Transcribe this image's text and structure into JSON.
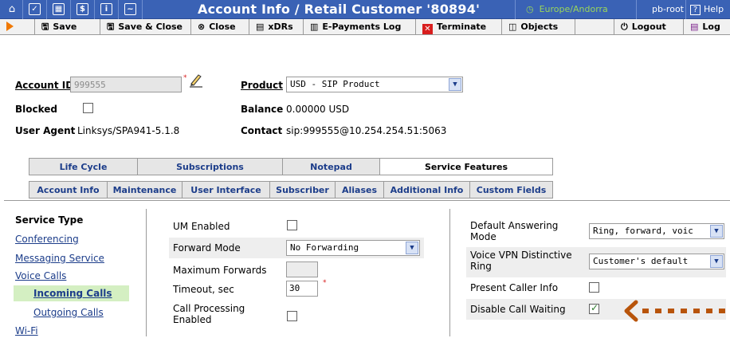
{
  "titlebar": {
    "title": "Account Info / Retail Customer '80894'",
    "timezone": "Europe/Andorra",
    "user": "pb-root",
    "help": "Help",
    "help_icon": "?",
    "bg_color": "#3a62b5",
    "timezone_color": "#9ad65a"
  },
  "toolbar": {
    "save": "Save",
    "save_close": "Save & Close",
    "close": "Close",
    "xdrs": "xDRs",
    "epayments": "E-Payments Log",
    "terminate": "Terminate",
    "objects": "Objects",
    "logout": "Logout",
    "log": "Log"
  },
  "account": {
    "account_id_label": "Account ID",
    "account_id_value": "999555",
    "product_label": "Product",
    "product_value": "USD - SIP Product",
    "blocked_label": "Blocked",
    "blocked": false,
    "balance_label": "Balance",
    "balance_value": "0.00000 USD",
    "user_agent_label": "User Agent",
    "user_agent_value": "Linksys/SPA941-5.1.8",
    "contact_label": "Contact",
    "contact_value": "sip:999555@10.254.254.51:5063"
  },
  "tabs_row1": [
    "Life Cycle",
    "Subscriptions",
    "Notepad",
    "Service Features"
  ],
  "tabs_row2": [
    "Account Info",
    "Maintenance",
    "User Interface",
    "Subscriber",
    "Aliases",
    "Additional Info",
    "Custom Fields"
  ],
  "active_tab": "Service Features",
  "nav": {
    "heading": "Service Type",
    "items": [
      "Conferencing",
      "Messaging Service",
      "Voice Calls",
      "Incoming Calls",
      "Outgoing Calls",
      "Wi-Fi"
    ],
    "selected": "Incoming Calls",
    "selected_color": "#d4efc2"
  },
  "middle": {
    "um_enabled_label": "UM Enabled",
    "um_enabled": false,
    "forward_mode_label": "Forward Mode",
    "forward_mode_value": "No Forwarding",
    "max_forwards_label": "Maximum Forwards",
    "max_forwards_value": "",
    "timeout_label": "Timeout, sec",
    "timeout_value": "30",
    "call_processing_label": "Call Processing Enabled",
    "call_processing": false
  },
  "right": {
    "default_answering_label": "Default Answering Mode",
    "default_answering_value": "Ring, forward, voic",
    "vpn_ring_label": "Voice VPN Distinctive Ring",
    "vpn_ring_value": "Customer's default",
    "present_caller_label": "Present Caller Info",
    "present_caller": false,
    "disable_call_waiting_label": "Disable Call Waiting",
    "disable_call_waiting": true
  },
  "annotation": {
    "arrow_color": "#b8540a"
  }
}
